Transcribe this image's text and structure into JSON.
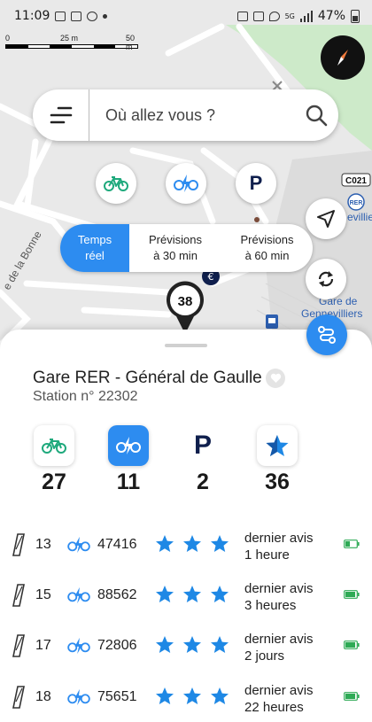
{
  "status_bar": {
    "time": "11:09",
    "battery": "47%",
    "network": "5G"
  },
  "map": {
    "scale": {
      "labels": [
        "0",
        "25 m",
        "50 m"
      ]
    },
    "labels": {
      "road_code": "C021",
      "street": "e de la Bonne",
      "rer": "RER",
      "gare_line1": "Gare de",
      "gare_line2": "Gennevilliers",
      "villiers": "evillie"
    }
  },
  "search": {
    "placeholder": "Où allez vous ?"
  },
  "view_toggle": {
    "options": [
      "Temps\nréel",
      "Prévisions\nà 30 min",
      "Prévisions\nà 60 min"
    ],
    "selected": 0
  },
  "marker": {
    "count": "38"
  },
  "station": {
    "name": "Gare RER - Général de Gaulle",
    "number": "Station n° 22302"
  },
  "counters": [
    {
      "type": "mechanical-bike",
      "value": "27"
    },
    {
      "type": "electric-bike",
      "value": "11"
    },
    {
      "type": "parking",
      "value": "2"
    },
    {
      "type": "rating",
      "value": "36"
    }
  ],
  "bikes": [
    {
      "slot": "13",
      "id": "47416",
      "stars": 3,
      "review": "dernier avis\n1 heure",
      "battery_level": 0.4
    },
    {
      "slot": "15",
      "id": "88562",
      "stars": 3,
      "review": "dernier avis\n3 heures",
      "battery_level": 0.9
    },
    {
      "slot": "17",
      "id": "72806",
      "stars": 3,
      "review": "dernier avis\n2 jours",
      "battery_level": 0.9
    },
    {
      "slot": "18",
      "id": "75651",
      "stars": 3,
      "review": "dernier avis\n22 heures",
      "battery_level": 0.9
    }
  ],
  "colors": {
    "accent": "#2d8cf0",
    "mechanical_bike": "#1ea97c",
    "parking": "#0f1f4d",
    "battery": "#2eaa55"
  }
}
